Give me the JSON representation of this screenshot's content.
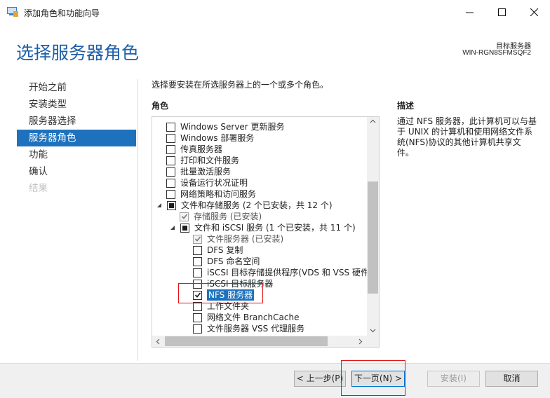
{
  "window": {
    "title": "添加角色和功能向导"
  },
  "header": {
    "page_title": "选择服务器角色",
    "destination_label": "目标服务器",
    "destination_server": "WIN-RGN8SFMSQF2"
  },
  "nav": {
    "items": [
      {
        "label": "开始之前",
        "state": "normal"
      },
      {
        "label": "安装类型",
        "state": "normal"
      },
      {
        "label": "服务器选择",
        "state": "normal"
      },
      {
        "label": "服务器角色",
        "state": "active"
      },
      {
        "label": "功能",
        "state": "normal"
      },
      {
        "label": "确认",
        "state": "normal"
      },
      {
        "label": "结果",
        "state": "disabled"
      }
    ]
  },
  "main": {
    "instructions": "选择要安装在所选服务器上的一个或多个角色。",
    "roles_label": "角色",
    "roles": [
      {
        "label": "Windows Server 更新服务",
        "check": "none"
      },
      {
        "label": "Windows 部署服务",
        "check": "none"
      },
      {
        "label": "传真服务器",
        "check": "none"
      },
      {
        "label": "打印和文件服务",
        "check": "none"
      },
      {
        "label": "批量激活服务",
        "check": "none"
      },
      {
        "label": "设备运行状况证明",
        "check": "none"
      },
      {
        "label": "网络策略和访问服务",
        "check": "none"
      },
      {
        "label": "文件和存储服务 (2 个已安装，共 12 个)",
        "check": "partial"
      },
      {
        "label": "存储服务 (已安装)",
        "check": "installed"
      },
      {
        "label": "文件和 iSCSI 服务 (1 个已安装，共 11 个)",
        "check": "partial"
      },
      {
        "label": "文件服务器 (已安装)",
        "check": "installed"
      },
      {
        "label": "DFS 复制",
        "check": "none"
      },
      {
        "label": "DFS 命名空间",
        "check": "none"
      },
      {
        "label": "iSCSI 目标存储提供程序(VDS 和 VSS 硬件提",
        "check": "none"
      },
      {
        "label": "iSCSI 目标服务器",
        "check": "none"
      },
      {
        "label": "NFS 服务器",
        "check": "checked"
      },
      {
        "label": "工作文件夹",
        "check": "none"
      },
      {
        "label": "网络文件 BranchCache",
        "check": "none"
      },
      {
        "label": "文件服务器 VSS 代理服务",
        "check": "none"
      }
    ]
  },
  "description": {
    "label": "描述",
    "text": "通过 NFS 服务器，此计算机可以与基于 UNIX 的计算机和使用网络文件系统(NFS)协议的其他计算机共享文件。"
  },
  "footer": {
    "prev_label": "< 上一步(P)",
    "next_label": "下一页(N) >",
    "install_label": "安装(I)",
    "cancel_label": "取消"
  },
  "colors": {
    "accent": "#1e72bd",
    "title_blue": "#1f5fa8",
    "annotation_red": "#e01515"
  }
}
